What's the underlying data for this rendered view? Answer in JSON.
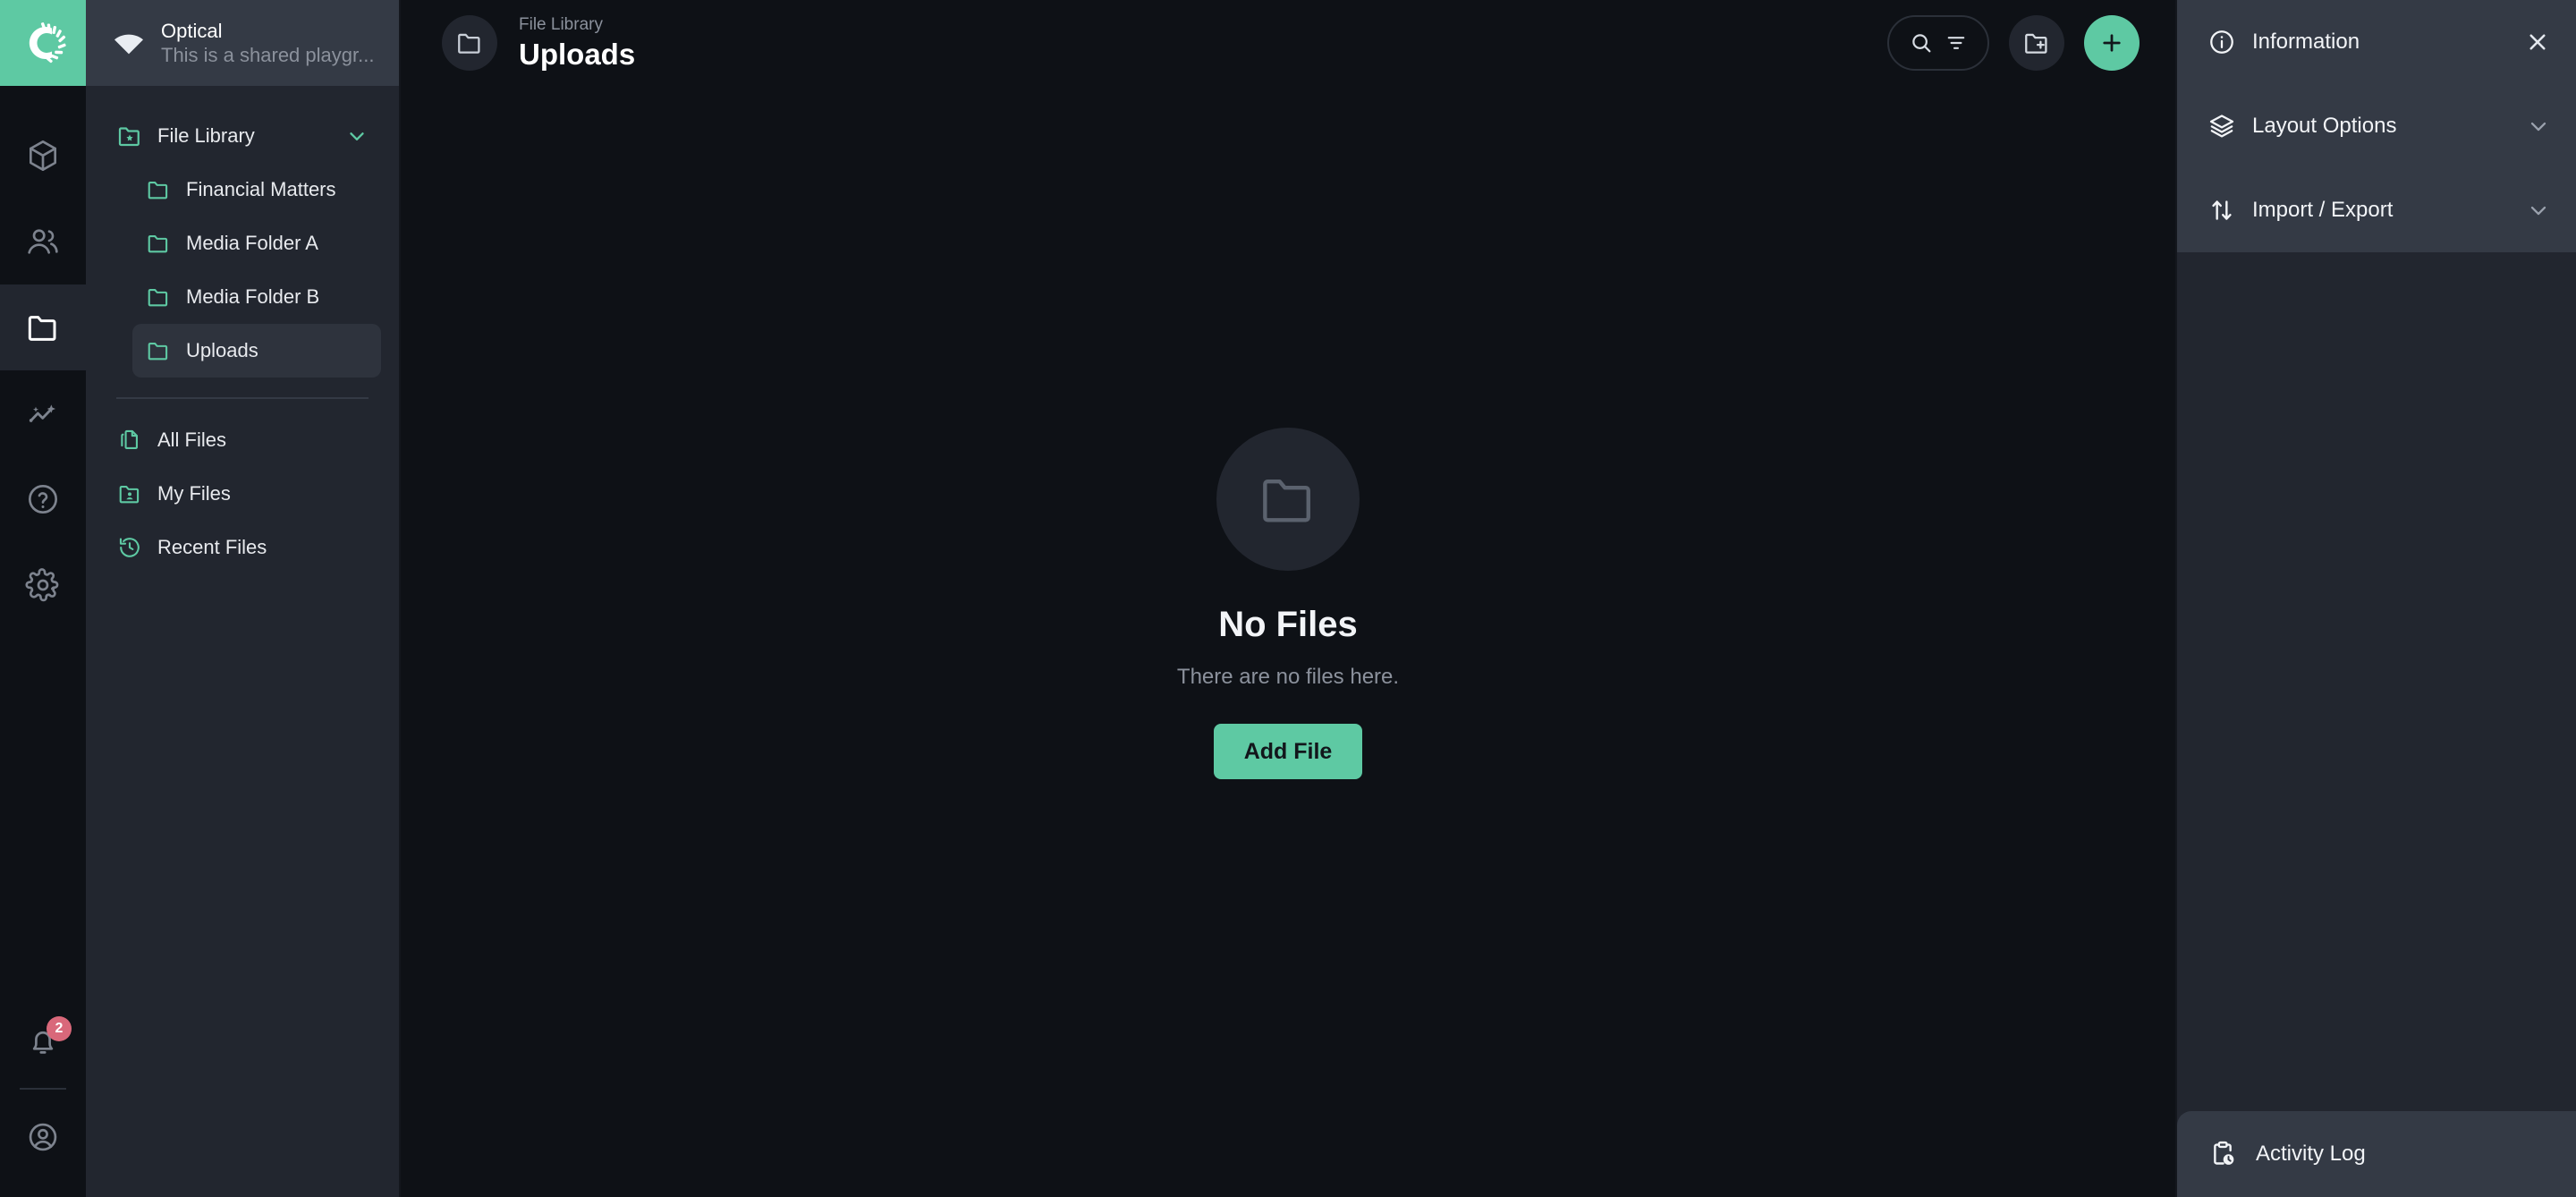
{
  "brand": {
    "logo_icon": "optical-ring-logo",
    "accent_color": "#5ec9a3",
    "badge_color": "#d9687a"
  },
  "rail": {
    "items": [
      {
        "icon": "cube-icon",
        "name": "rail-item-models",
        "active": false
      },
      {
        "icon": "people-icon",
        "name": "rail-item-people",
        "active": false
      },
      {
        "icon": "folder-icon",
        "name": "rail-item-files",
        "active": true
      },
      {
        "icon": "insights-sparkle-icon",
        "name": "rail-item-insights",
        "active": false
      },
      {
        "icon": "help-circle-icon",
        "name": "rail-item-help",
        "active": false
      },
      {
        "icon": "gear-icon",
        "name": "rail-item-settings",
        "active": false
      }
    ],
    "notifications": {
      "icon": "bell-icon",
      "count": "2"
    },
    "account": {
      "icon": "account-circle-icon"
    }
  },
  "workspace": {
    "icon": "workspace-fan-icon",
    "name": "Optical",
    "description": "This is a shared playgr..."
  },
  "sidebar": {
    "group": {
      "icon": "folder-star-icon",
      "label": "File Library",
      "chevron": "chevron-down-icon",
      "expanded": true
    },
    "folders": [
      {
        "icon": "folder-icon",
        "label": "Financial Matters",
        "selected": false
      },
      {
        "icon": "folder-icon",
        "label": "Media Folder A",
        "selected": false
      },
      {
        "icon": "folder-icon",
        "label": "Media Folder B",
        "selected": false
      },
      {
        "icon": "folder-icon",
        "label": "Uploads",
        "selected": true
      }
    ],
    "links": [
      {
        "icon": "documents-copy-icon",
        "label": "All Files"
      },
      {
        "icon": "folder-user-icon",
        "label": "My Files"
      },
      {
        "icon": "history-clock-icon",
        "label": "Recent Files"
      }
    ]
  },
  "header": {
    "crumb_icon": "folder-icon",
    "parent": "File Library",
    "title": "Uploads",
    "actions": {
      "search_icon": "search-icon",
      "filter_icon": "filter-icon",
      "new_folder_icon": "folder-plus-icon",
      "add_icon": "plus-icon"
    }
  },
  "empty_state": {
    "icon": "folder-icon",
    "title": "No Files",
    "subtitle": "There are no files here.",
    "button_label": "Add File"
  },
  "right_panel": {
    "rows": [
      {
        "icon": "info-circle-icon",
        "label": "Information",
        "action_icon": "close-icon"
      },
      {
        "icon": "layers-icon",
        "label": "Layout Options",
        "action_icon": "chevron-down-icon"
      },
      {
        "icon": "import-export-arrows-icon",
        "label": "Import / Export",
        "action_icon": "chevron-down-icon"
      }
    ],
    "footer": {
      "icon": "clipboard-clock-icon",
      "label": "Activity Log"
    }
  }
}
